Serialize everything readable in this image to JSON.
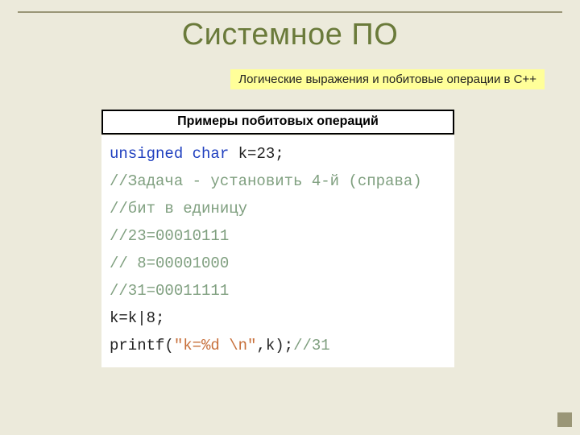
{
  "slide": {
    "title": "Системное ПО",
    "subtitle": "Логические выражения и побитовые операции в С++",
    "section_label": "Примеры побитовых операций"
  },
  "code": {
    "line1_kw1": "unsigned",
    "line1_kw2": "char",
    "line1_rest": " k=23;",
    "line2": "//Задача - установить 4-й (справа)",
    "line3": "//бит в единицу",
    "line4": "//23=00010111",
    "line5": "// 8=00001000",
    "line6": "//31=00011111",
    "line7": "k=k|8;",
    "line8_a": "printf(",
    "line8_str": "\"k=%d \\n\"",
    "line8_b": ",k);",
    "line8_cmt": "//31"
  }
}
